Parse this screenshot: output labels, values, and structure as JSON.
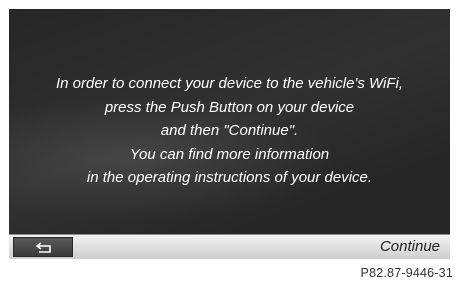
{
  "message": {
    "lines": [
      "In order to connect your device to the vehicle's WiFi,",
      "press the Push Button on your device",
      "and then \"Continue\".",
      "You can find more information",
      "in the operating instructions of your device."
    ]
  },
  "bar": {
    "back_icon": "back-arrow-icon",
    "continue_label": "Continue"
  },
  "figure_code": "P82.87-9446-31",
  "colors": {
    "screen_background": "#262626",
    "text": "#ffffff",
    "bar": "#e3e3e3",
    "back_button": "#4a4a4a"
  }
}
